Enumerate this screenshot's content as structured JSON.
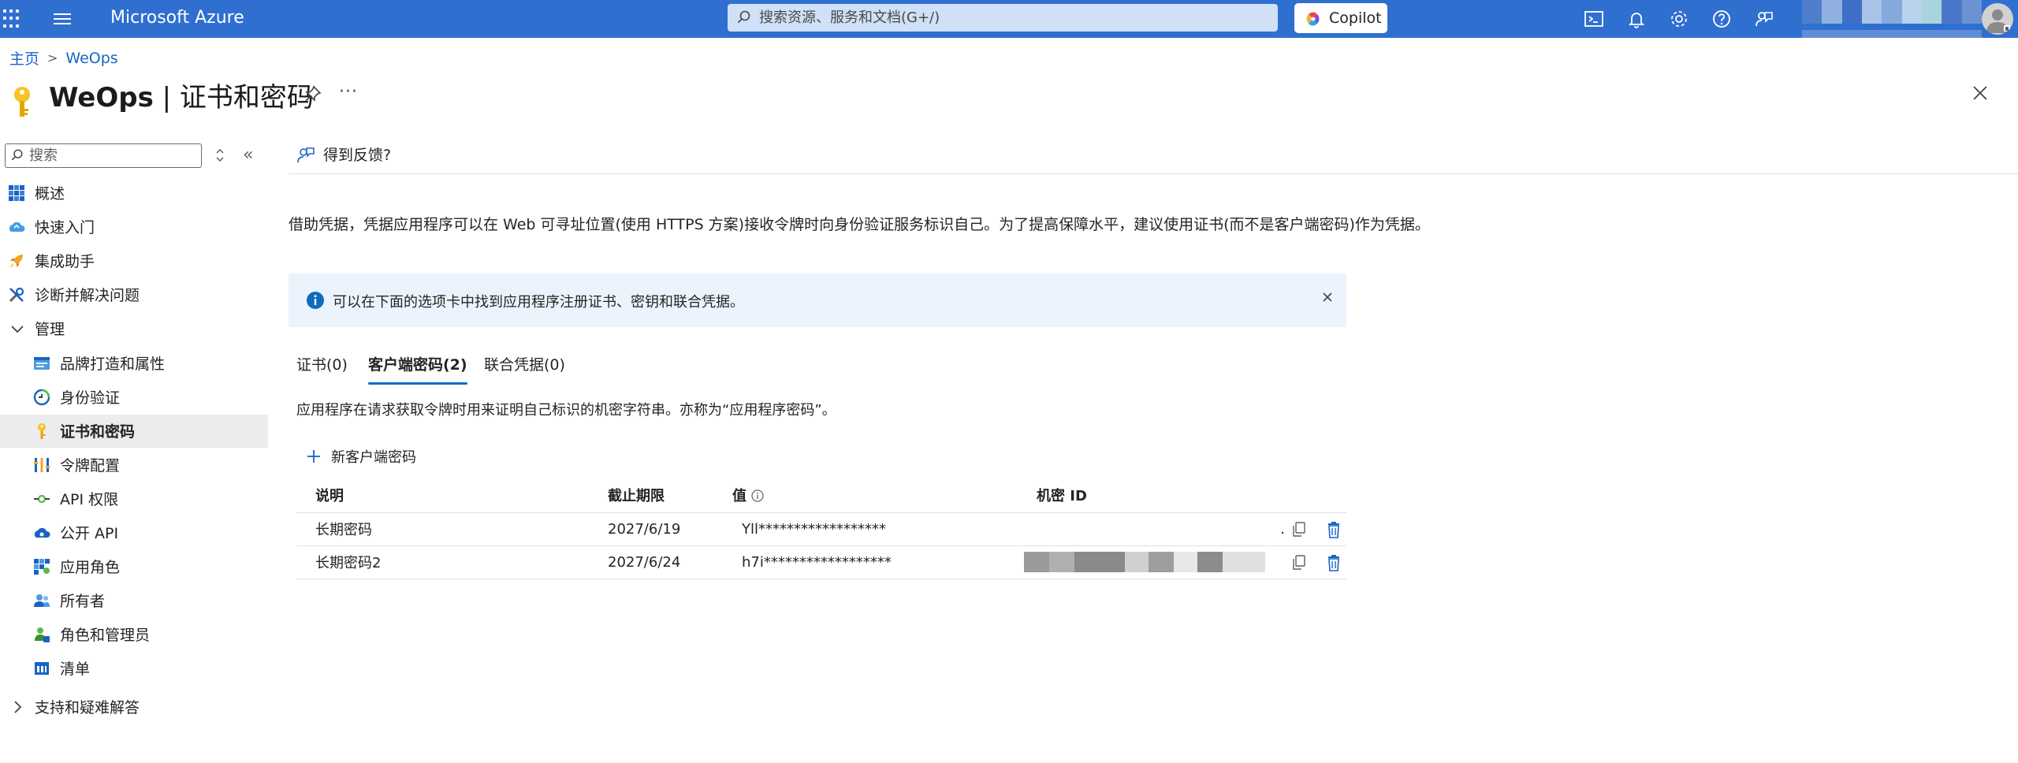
{
  "app": {
    "brand": "Microsoft Azure",
    "search_placeholder": "搜索资源、服务和文档(G+/)",
    "copilot_label": "Copilot"
  },
  "breadcrumb": {
    "home": "主页",
    "current": "WeOps"
  },
  "header": {
    "title_app": "WeOps",
    "title_sep": " | ",
    "title_page": "证书和密码",
    "more": "···"
  },
  "sidebar": {
    "search_placeholder": "搜索",
    "items": [
      {
        "label": "概述",
        "icon": "overview-grid-icon"
      },
      {
        "label": "快速入门",
        "icon": "cloud-quickstart-icon"
      },
      {
        "label": "集成助手",
        "icon": "rocket-icon"
      },
      {
        "label": "诊断并解决问题",
        "icon": "wrench-icon"
      },
      {
        "label": "管理",
        "icon": "chevron-down-icon"
      },
      {
        "label": "品牌打造和属性",
        "icon": "branding-icon"
      },
      {
        "label": "身份验证",
        "icon": "authentication-icon"
      },
      {
        "label": "证书和密码",
        "icon": "key-icon"
      },
      {
        "label": "令牌配置",
        "icon": "token-bars-icon"
      },
      {
        "label": "API 权限",
        "icon": "api-permission-icon"
      },
      {
        "label": "公开 API",
        "icon": "cloud-api-icon"
      },
      {
        "label": "应用角色",
        "icon": "app-roles-icon"
      },
      {
        "label": "所有者",
        "icon": "owners-icon"
      },
      {
        "label": "角色和管理员",
        "icon": "roles-admins-icon"
      },
      {
        "label": "清单",
        "icon": "manifest-icon"
      },
      {
        "label": "支持和疑难解答",
        "icon": "chevron-right-icon"
      }
    ]
  },
  "main": {
    "feedback": "得到反馈?",
    "description": "借助凭据，凭据应用程序可以在 Web 可寻址位置(使用 HTTPS 方案)接收令牌时向身份验证服务标识自己。为了提高保障水平，建议使用证书(而不是客户端密码)作为凭据。",
    "info_message": "可以在下面的选项卡中找到应用程序注册证书、密钥和联合凭据。",
    "tabs": [
      {
        "label": "证书(0)"
      },
      {
        "label": "客户端密码(2)"
      },
      {
        "label": "联合凭据(0)"
      }
    ],
    "tab_description": "应用程序在请求获取令牌时用来证明自己标识的机密字符串。亦称为“应用程序密码”。",
    "add_button": "新客户端密码",
    "table": {
      "headers": [
        "说明",
        "截止期限",
        "值",
        "机密 ID"
      ],
      "rows": [
        {
          "description": "长期密码",
          "expires": "2027/6/19",
          "value": "Yll******************",
          "secret_id": "."
        },
        {
          "description": "长期密码2",
          "expires": "2027/6/24",
          "value": "h7i******************",
          "secret_id": ""
        }
      ]
    }
  },
  "colors": {
    "topbar": "#2f6fd0",
    "accent": "#0f6cbd",
    "info_bg": "#ebf3fc",
    "active_nav": "#ececec",
    "delete": "#1a63c5"
  }
}
